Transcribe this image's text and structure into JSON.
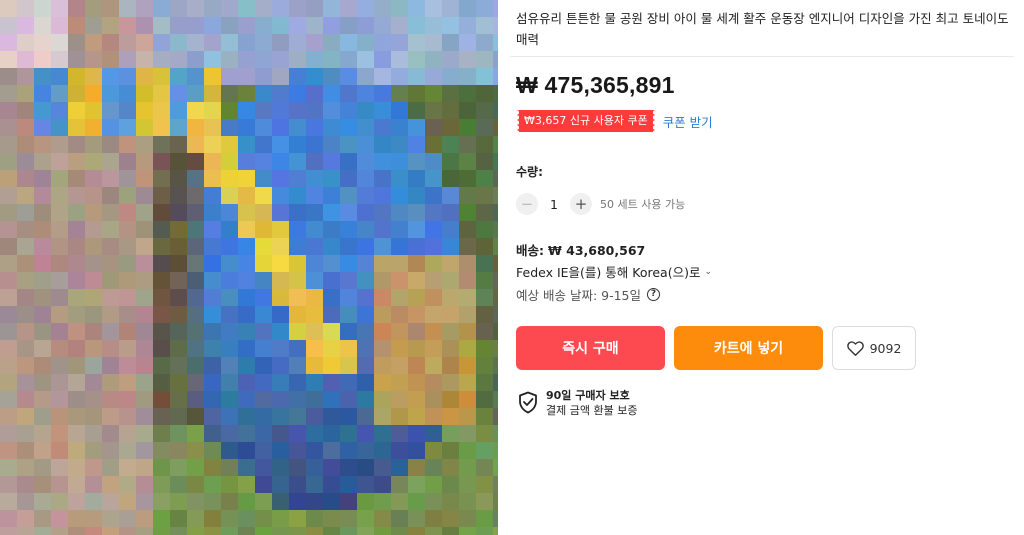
{
  "product": {
    "title": "섬유유리 튼튼한 물 공원 장비 아이 물 세계 활주 운동장 엔지니어 디자인을 가진 최고 토네이도 매력",
    "price": "₩ 475,365,891",
    "image_icon": "blurred-product-photo"
  },
  "coupon": {
    "badge": "₩3,657 신규 사용자 쿠폰",
    "link": "쿠폰 받기"
  },
  "quantity": {
    "label": "수량:",
    "value": "1",
    "minus_icon": "minus-icon",
    "plus_icon": "plus-icon",
    "available": "50 세트 사용 가능"
  },
  "shipping": {
    "label": "배송:",
    "cost": "₩ 43,680,567",
    "method": "Fedex IE을(를) 통해 Korea(으)로",
    "eta": "예상 배송 날짜: 9-15일"
  },
  "actions": {
    "buy_now": "즉시 구매",
    "add_to_cart": "카트에 넣기",
    "wishlist_count": "9092"
  },
  "protection": {
    "title": "90일 구매자 보호",
    "subtitle": "결제 금액 환불 보증"
  },
  "colors": {
    "buy": "#fd4a50",
    "cart": "#fd8c0d",
    "coupon": "#ff3a3a",
    "link": "#2e7bd6"
  }
}
